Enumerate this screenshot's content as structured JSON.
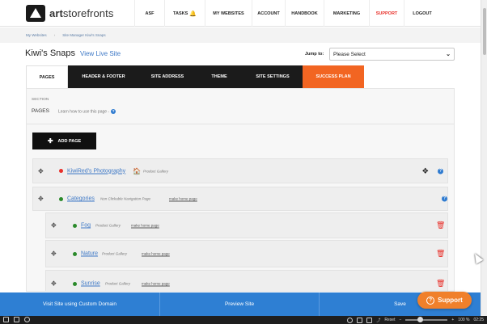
{
  "brand": {
    "name_bold": "art",
    "name_rest": "storefronts"
  },
  "nav": {
    "items": [
      "ASF",
      "TASKS",
      "MY WEBSITES",
      "ACCOUNT",
      "HANDBOOK",
      "MARKETING",
      "SUPPORT",
      "LOGOUT"
    ],
    "active_color": "#e8302a"
  },
  "breadcrumb": [
    "My Websites",
    "Site Manager Kiwi's Snaps"
  ],
  "site": {
    "title": "Kiwi's Snaps",
    "view_live": "View Live Site"
  },
  "jump": {
    "label": "Jump to:",
    "value": "Please Select"
  },
  "tabs": [
    "PAGES",
    "HEADER & FOOTER",
    "SITE ADDRESS",
    "THEME",
    "SITE SETTINGS",
    "SUCCESS PLAN"
  ],
  "section": {
    "label": "SECTION",
    "name": "PAGES",
    "help": "Learn how to use this page -"
  },
  "add_page_label": "ADD PAGE",
  "pages": [
    {
      "title": "KiwiRed's Photography",
      "type": "Product Gallery",
      "status_color": "#e8302a",
      "level": 0,
      "is_home": true
    },
    {
      "title": "Categories",
      "type": "Non Clickable Navigation Page",
      "make_home": "make home page",
      "status_color": "#2a8a2a",
      "level": 0
    },
    {
      "title": "Fog",
      "type": "Product Gallery",
      "make_home": "make home page",
      "status_color": "#2a8a2a",
      "level": 1
    },
    {
      "title": "Nature",
      "type": "Product Gallery",
      "make_home": "make home page",
      "status_color": "#2a8a2a",
      "level": 1
    },
    {
      "title": "Sunrise",
      "type": "Product Gallery",
      "make_home": "make home page",
      "status_color": "#2a8a2a",
      "level": 1
    }
  ],
  "bottom": {
    "custom_domain": "Visit Site using Custom Domain",
    "preview": "Preview Site",
    "save": "Save"
  },
  "support_label": "Support",
  "taskbar": {
    "reset": "Reset",
    "zoom": "100 %",
    "time": "02:25"
  },
  "colors": {
    "accent_blue": "#2e7fd3",
    "orange": "#f26522",
    "support_orange": "#f0802b"
  }
}
